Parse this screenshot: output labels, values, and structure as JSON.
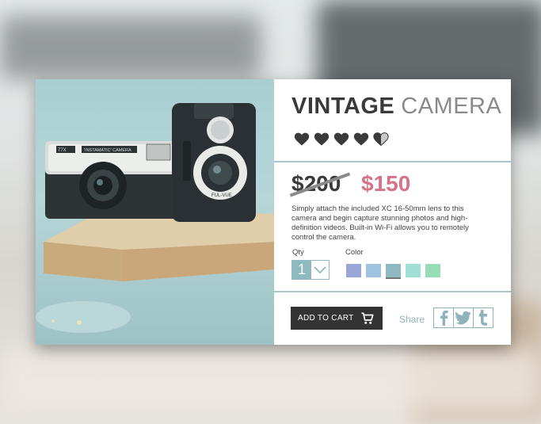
{
  "product": {
    "title_bold": "VINTAGE",
    "title_light": "CAMERA",
    "rating": 4.5,
    "rating_max": 5,
    "old_price": "$200",
    "new_price": "$150",
    "description": "Simply attach the included XC 16-50mm lens to this camera and begin capture stunning photos and high-definition videos. Built-in Wi-Fi allows you to remotely control the camera.",
    "qty_label": "Qty",
    "qty_value": "1",
    "color_label": "Color",
    "colors": [
      "#9aa6d8",
      "#9ec2e0",
      "#8fb9c0",
      "#9fe0d6",
      "#99dcb8"
    ],
    "selected_color_index": 2,
    "add_to_cart_label": "ADD TO CART",
    "share_label": "Share"
  },
  "photo_camera_labels": {
    "left_model": "77X",
    "left_name": "'INSTAMATIC' CAMERA",
    "right_name": "FUL-VUE"
  },
  "accent_colors": {
    "sale_price": "#d57389",
    "rule": "#a9c6cc",
    "button": "#333333",
    "share": "#8fb3bb"
  },
  "icons": [
    "heart-icon",
    "chevron-down-icon",
    "cart-icon",
    "facebook-icon",
    "twitter-icon",
    "tumblr-icon"
  ]
}
